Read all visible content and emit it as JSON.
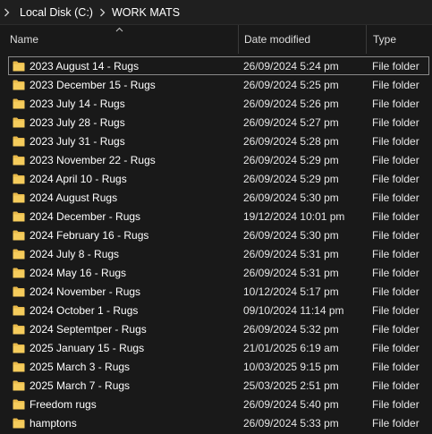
{
  "breadcrumb": {
    "items": [
      "Local Disk (C:)",
      "WORK MATS"
    ]
  },
  "columns": {
    "name": "Name",
    "date_modified": "Date modified",
    "type": "Type"
  },
  "colors": {
    "background": "#191919",
    "folder": "#e8b94a",
    "text": "#ffffff"
  },
  "icons": {
    "breadcrumb_separator": "chevron-right-icon",
    "sort": "sort-ascending-icon",
    "folder": "folder-icon"
  },
  "rows": [
    {
      "name": "2023 August 14 - Rugs",
      "date": "26/09/2024 5:24 pm",
      "type": "File folder"
    },
    {
      "name": "2023 December 15 - Rugs",
      "date": "26/09/2024 5:25 pm",
      "type": "File folder"
    },
    {
      "name": "2023 July 14 - Rugs",
      "date": "26/09/2024 5:26 pm",
      "type": "File folder"
    },
    {
      "name": "2023 July 28 - Rugs",
      "date": "26/09/2024 5:27 pm",
      "type": "File folder"
    },
    {
      "name": "2023 July 31 - Rugs",
      "date": "26/09/2024 5:28 pm",
      "type": "File folder"
    },
    {
      "name": "2023 November 22 - Rugs",
      "date": "26/09/2024 5:29 pm",
      "type": "File folder"
    },
    {
      "name": "2024 April 10 - Rugs",
      "date": "26/09/2024 5:29 pm",
      "type": "File folder"
    },
    {
      "name": "2024 August Rugs",
      "date": "26/09/2024 5:30 pm",
      "type": "File folder"
    },
    {
      "name": "2024 December - Rugs",
      "date": "19/12/2024 10:01 pm",
      "type": "File folder"
    },
    {
      "name": "2024 February 16 - Rugs",
      "date": "26/09/2024 5:30 pm",
      "type": "File folder"
    },
    {
      "name": "2024 July 8 - Rugs",
      "date": "26/09/2024 5:31 pm",
      "type": "File folder"
    },
    {
      "name": "2024 May 16 - Rugs",
      "date": "26/09/2024 5:31 pm",
      "type": "File folder"
    },
    {
      "name": "2024 November - Rugs",
      "date": "10/12/2024 5:17 pm",
      "type": "File folder"
    },
    {
      "name": "2024 October 1 - Rugs",
      "date": "09/10/2024 11:14 pm",
      "type": "File folder"
    },
    {
      "name": "2024 Septemtper - Rugs",
      "date": "26/09/2024 5:32 pm",
      "type": "File folder"
    },
    {
      "name": "2025 January 15 - Rugs",
      "date": "21/01/2025 6:19 am",
      "type": "File folder"
    },
    {
      "name": "2025 March 3 - Rugs",
      "date": "10/03/2025 9:15 pm",
      "type": "File folder"
    },
    {
      "name": "2025 March 7 - Rugs",
      "date": "25/03/2025 2:51 pm",
      "type": "File folder"
    },
    {
      "name": "Freedom rugs",
      "date": "26/09/2024 5:40 pm",
      "type": "File folder"
    },
    {
      "name": "hamptons",
      "date": "26/09/2024 5:33 pm",
      "type": "File folder"
    }
  ]
}
